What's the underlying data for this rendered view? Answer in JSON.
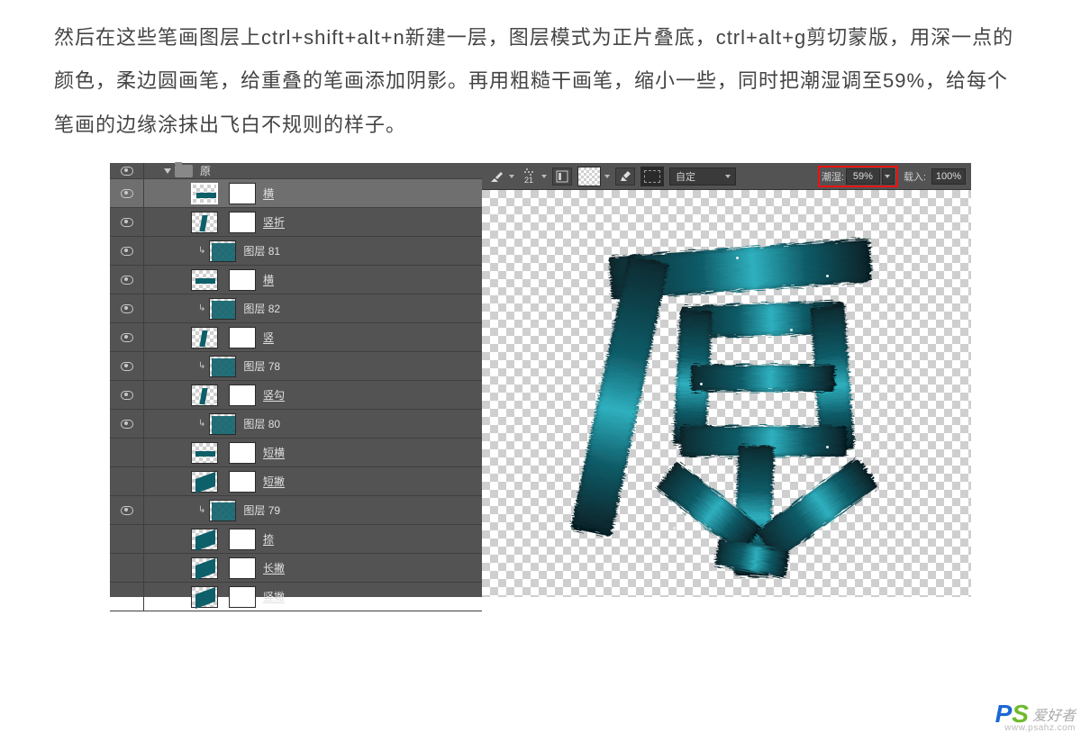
{
  "tutorial": {
    "paragraph": "然后在这些笔画图层上ctrl+shift+alt+n新建一层，图层模式为正片叠底，ctrl+alt+g剪切蒙版，用深一点的颜色，柔边圆画笔，给重叠的笔画添加阴影。再用粗糙干画笔，缩小一些，同时把潮湿调至59%，给每个笔画的边缘涂抹出飞白不规则的样子。"
  },
  "layers": {
    "group_name": "原",
    "items": [
      {
        "name": "横",
        "indent": "g2",
        "vis": true,
        "mask": true,
        "thumb": "h",
        "clip": false,
        "selected": true
      },
      {
        "name": "竖折",
        "indent": "g2",
        "vis": true,
        "mask": true,
        "thumb": "sz",
        "clip": false
      },
      {
        "name": "图层 81",
        "indent": "g3",
        "vis": true,
        "mask": false,
        "thumb": "full",
        "clip": true
      },
      {
        "name": "横",
        "indent": "g2",
        "vis": true,
        "mask": true,
        "thumb": "h",
        "clip": false
      },
      {
        "name": "图层 82",
        "indent": "g3",
        "vis": true,
        "mask": false,
        "thumb": "full",
        "clip": true
      },
      {
        "name": "竖",
        "indent": "g2",
        "vis": true,
        "mask": true,
        "thumb": "sz",
        "clip": false
      },
      {
        "name": "图层 78",
        "indent": "g3",
        "vis": true,
        "mask": false,
        "thumb": "full",
        "clip": true
      },
      {
        "name": "竖勾",
        "indent": "g2",
        "vis": true,
        "mask": true,
        "thumb": "sz",
        "clip": false
      },
      {
        "name": "图层 80",
        "indent": "g3",
        "vis": true,
        "mask": false,
        "thumb": "full",
        "clip": true
      },
      {
        "name": "短横",
        "indent": "g2",
        "vis": false,
        "mask": true,
        "thumb": "h",
        "clip": false
      },
      {
        "name": "短撇",
        "indent": "g2",
        "vis": false,
        "mask": true,
        "thumb": "diag",
        "clip": false
      },
      {
        "name": "图层 79",
        "indent": "g3",
        "vis": true,
        "mask": false,
        "thumb": "full",
        "clip": true
      },
      {
        "name": "捺",
        "indent": "g2",
        "vis": false,
        "mask": true,
        "thumb": "diag",
        "clip": false
      },
      {
        "name": "长撇",
        "indent": "g2",
        "vis": false,
        "mask": true,
        "thumb": "diag",
        "clip": false
      },
      {
        "name": "竖撇",
        "indent": "g2",
        "vis": false,
        "mask": true,
        "thumb": "diag",
        "clip": false
      }
    ]
  },
  "toolbar": {
    "brush_size": "21",
    "mode_label": "自定",
    "wet_label": "潮湿:",
    "wet_value": "59%",
    "load_label": "载入:",
    "load_value": "100%"
  },
  "watermark": {
    "p": "P",
    "s": "S",
    "text": "爱好者",
    "url": "www.psahz.com"
  }
}
